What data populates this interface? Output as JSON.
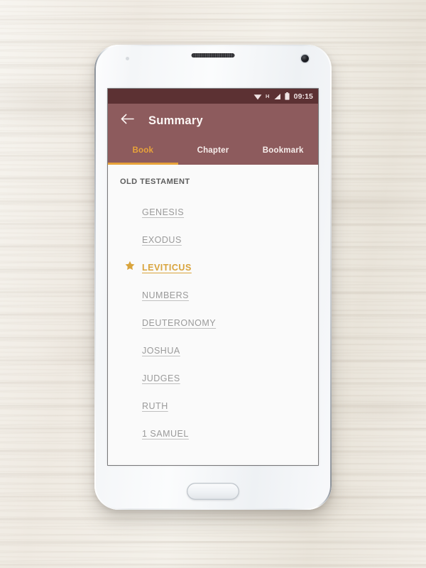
{
  "device": {
    "label": "white-android-smartphone",
    "earpiece": "earpiece-speaker-grille",
    "front_camera": "front-camera-lens",
    "home_button": "physical-home-button"
  },
  "backdrop": {
    "label": "whitewashed-wood-plank-surface"
  },
  "status_bar": {
    "wifi_icon": "wifi-icon",
    "network_type": "H",
    "signal_icon": "cellular-signal-icon",
    "battery_icon": "battery-full-icon",
    "time": "09:15",
    "background_color": "#5c3133"
  },
  "app_bar": {
    "back_icon": "back-arrow-icon",
    "title": "Summary",
    "background_color": "#8d5b5d",
    "text_color": "#fdf7f5"
  },
  "tabs": {
    "accent_color": "#e8a33a",
    "items": [
      {
        "label": "Book",
        "active": true
      },
      {
        "label": "Chapter",
        "active": false
      },
      {
        "label": "Bookmark",
        "active": false
      }
    ]
  },
  "book_list": {
    "section_header": "OLD TESTAMENT",
    "default_color": "#9a9a9a",
    "selected_color": "#d9a43c",
    "items": [
      {
        "name": "GENESIS",
        "selected": false,
        "bookmarked": false
      },
      {
        "name": "EXODUS",
        "selected": false,
        "bookmarked": false
      },
      {
        "name": "LEVITICUS",
        "selected": true,
        "bookmarked": true
      },
      {
        "name": "NUMBERS",
        "selected": false,
        "bookmarked": false
      },
      {
        "name": "DEUTERONOMY",
        "selected": false,
        "bookmarked": false
      },
      {
        "name": "JOSHUA",
        "selected": false,
        "bookmarked": false
      },
      {
        "name": "JUDGES",
        "selected": false,
        "bookmarked": false
      },
      {
        "name": "RUTH",
        "selected": false,
        "bookmarked": false
      },
      {
        "name": "1 SAMUEL",
        "selected": false,
        "bookmarked": false
      }
    ]
  },
  "nav_bar": {
    "background_color": "#060606",
    "buttons": [
      {
        "icon": "android-back-triangle-icon"
      },
      {
        "icon": "android-home-circle-icon"
      },
      {
        "icon": "android-recents-square-icon"
      }
    ]
  }
}
